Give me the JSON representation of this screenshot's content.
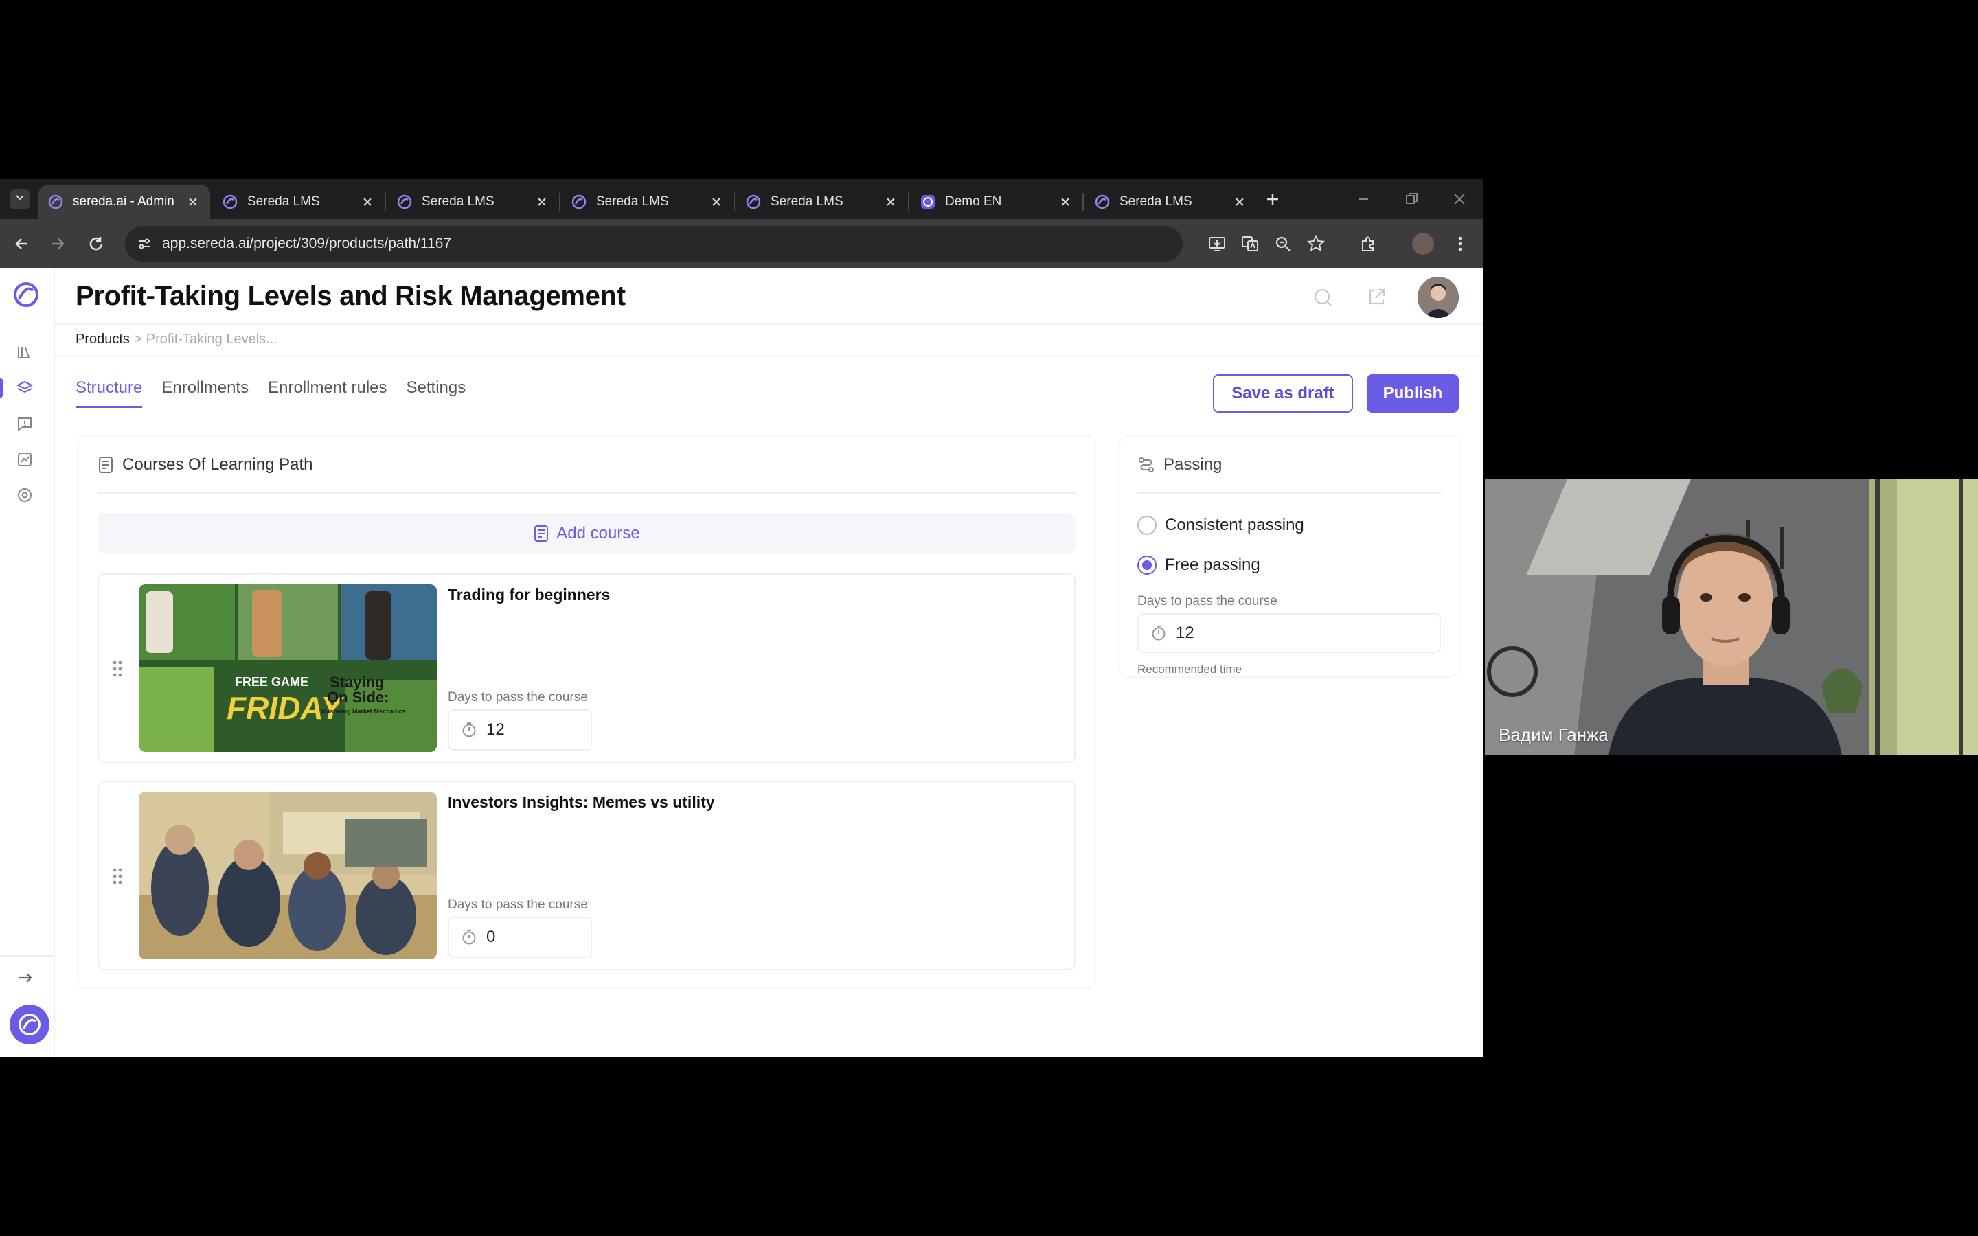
{
  "browser": {
    "tabs": [
      {
        "title": "sereda.ai - Admin",
        "active": true,
        "favicon": "sereda-logo-icon"
      },
      {
        "title": "Sereda LMS",
        "active": false,
        "favicon": "sereda-logo-icon"
      },
      {
        "title": "Sereda LMS",
        "active": false,
        "favicon": "sereda-logo-icon"
      },
      {
        "title": "Sereda LMS",
        "active": false,
        "favicon": "sereda-logo-icon"
      },
      {
        "title": "Sereda LMS",
        "active": false,
        "favicon": "sereda-logo-icon"
      },
      {
        "title": "Demo EN",
        "active": false,
        "favicon": "sereda-logo-icon"
      },
      {
        "title": "Sereda LMS",
        "active": false,
        "favicon": "sereda-logo-icon"
      }
    ],
    "url": "app.sereda.ai/project/309/products/path/1167",
    "colors": {
      "frame": "#1f1f1f",
      "toolbar": "#3c3c3c",
      "accent": "#6b5ce7"
    }
  },
  "page": {
    "title": "Profit-Taking Levels and Risk Management",
    "breadcrumb": {
      "root": "Products",
      "separator": ">",
      "current": "Profit-Taking Levels..."
    },
    "tabs": [
      "Structure",
      "Enrollments",
      "Enrollment rules",
      "Settings"
    ],
    "active_tab": "Structure",
    "actions": {
      "save_draft": "Save as draft",
      "publish": "Publish"
    }
  },
  "courses_panel": {
    "heading": "Courses Of Learning Path",
    "add_course": "Add course",
    "courses": [
      {
        "title": "Trading for beginners",
        "days_label": "Days to pass the course",
        "days": "12",
        "thumb_text": [
          "FREE GAME",
          "FRIDAY",
          "Staying",
          "On Side:",
          "Mastering Market Mechanics"
        ]
      },
      {
        "title": "Investors Insights: Memes vs utility",
        "days_label": "Days to pass the course",
        "days": "0"
      }
    ]
  },
  "passing_panel": {
    "heading": "Passing",
    "options": [
      {
        "label": "Consistent passing",
        "selected": false
      },
      {
        "label": "Free passing",
        "selected": true
      }
    ],
    "days_label": "Days to pass the course",
    "days": "12",
    "hint": "Recommended time"
  },
  "video": {
    "participant_name": "Вадим Ганжа"
  }
}
